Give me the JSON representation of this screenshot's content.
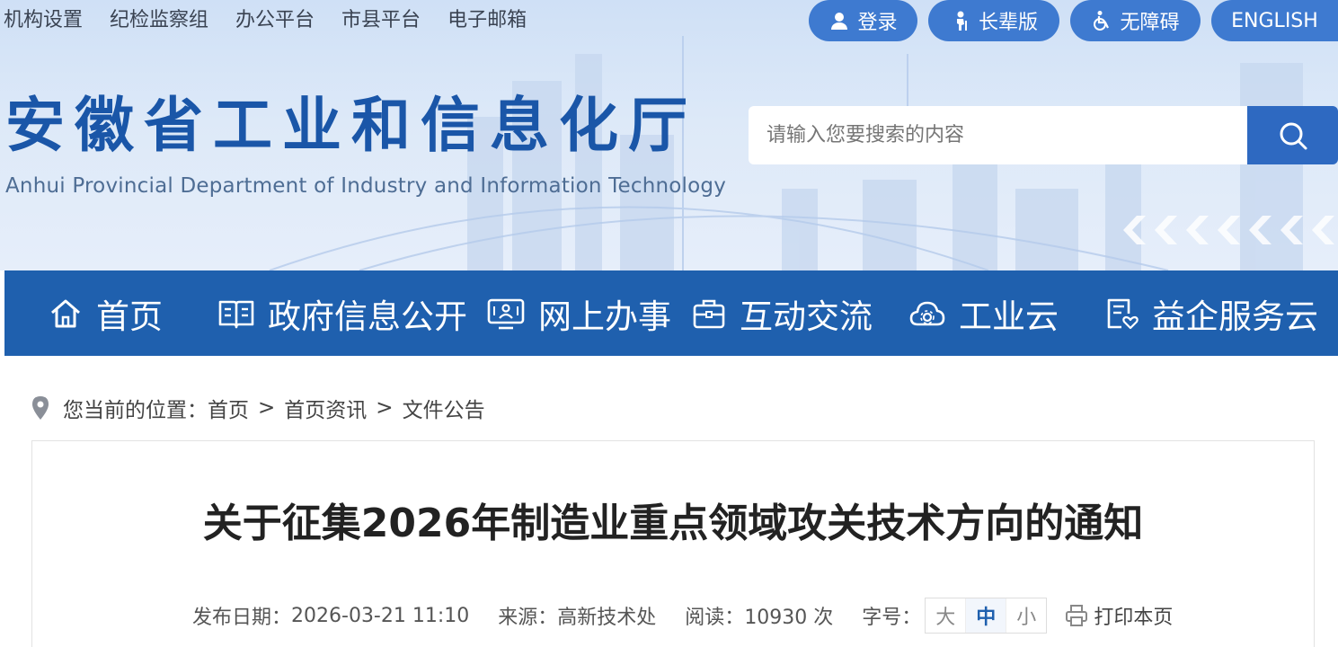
{
  "top_links": [
    "机构设置",
    "纪检监察组",
    "办公平台",
    "市县平台",
    "电子邮箱"
  ],
  "pills": {
    "login": "登录",
    "elder": "长辈版",
    "accessible": "无障碍",
    "english": "ENGLISH"
  },
  "site": {
    "title": "安徽省工业和信息化厅",
    "subtitle": "Anhui Provincial Department of Industry and Information Technology"
  },
  "search": {
    "placeholder": "请输入您要搜索的内容"
  },
  "nav": {
    "home": "首页",
    "gov_info": "政府信息公开",
    "online_service": "网上办事",
    "interaction": "互动交流",
    "industry_cloud": "工业云",
    "enterprise_cloud": "益企服务云"
  },
  "breadcrumb": {
    "prefix": "您当前的位置：",
    "items": [
      "首页",
      "首页资讯",
      "文件公告"
    ],
    "separator": ">"
  },
  "article": {
    "title": "关于征集2026年制造业重点领域攻关技术方向的通知",
    "date_label": "发布日期：",
    "date": "2026-03-21 11:10",
    "source_label": "来源：",
    "source": "高新技术处",
    "views_label": "阅读：",
    "views": "10930 次",
    "font_label": "字号：",
    "font_sizes": [
      "大",
      "中",
      "小"
    ],
    "font_selected": "中",
    "print": "打印本页"
  },
  "colors": {
    "primary": "#1f60ae",
    "pill": "#3e7ad0",
    "title_blue": "#1a56a8"
  }
}
